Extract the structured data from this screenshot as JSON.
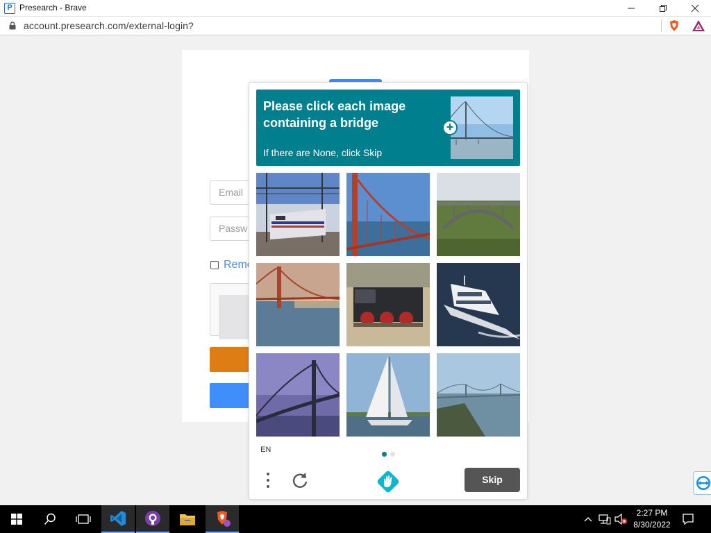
{
  "window": {
    "title": "Presearch - Brave",
    "app_icon_glyph": "P",
    "controls": {
      "minimize": "minimize-icon",
      "maximize": "restore-icon",
      "close": "close-icon"
    }
  },
  "addressbar": {
    "url": "account.presearch.com/external-login?",
    "icons": [
      "lock-icon",
      "brave-shield-icon",
      "brave-rewards-icon"
    ]
  },
  "login": {
    "email_placeholder": "Email",
    "password_placeholder": "Passw",
    "remember_label": "Reme",
    "accent_color": "#3f8efc",
    "orange_button_color": "#de7d14"
  },
  "challenge": {
    "prompt_title": "Please click each image containing a bridge",
    "prompt_sub": "If there are None, click Skip",
    "prompt_color": "#007f8e",
    "tiles": [
      {
        "name": "train-image"
      },
      {
        "name": "red-suspension-bridge-image"
      },
      {
        "name": "arch-bridge-image"
      },
      {
        "name": "sunset-bridge-image"
      },
      {
        "name": "steam-locomotive-image"
      },
      {
        "name": "yacht-image"
      },
      {
        "name": "night-bridge-image"
      },
      {
        "name": "sailboat-image"
      },
      {
        "name": "distant-bridge-image"
      }
    ],
    "language": "EN",
    "skip_label": "Skip"
  },
  "taskbar": {
    "apps": [
      "windows-start-icon",
      "search-icon",
      "task-view-icon",
      "vscode-icon",
      "github-desktop-icon",
      "file-explorer-icon",
      "brave-browser-icon"
    ],
    "time": "2:27 PM",
    "date": "8/30/2022"
  }
}
